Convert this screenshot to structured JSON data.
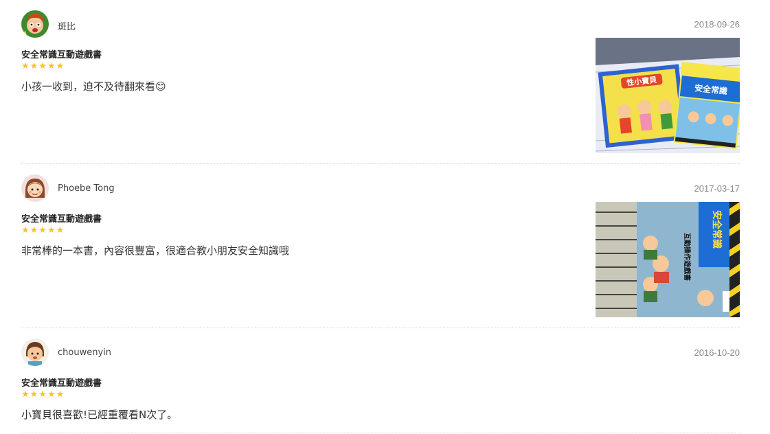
{
  "reviews": [
    {
      "user": "斑比",
      "date": "2018-09-26",
      "product": "安全常識互動遊戲書",
      "rating": 5,
      "stars": "★★★★★",
      "comment": "小孩一收到，迫不及待翻來看😊",
      "avatar_icon": "boy-cartoon-avatar",
      "photo_title_left": "性小寶貝",
      "photo_title_right": "安全常識"
    },
    {
      "user": "Phoebe Tong",
      "date": "2017-03-17",
      "product": "安全常識互動遊戲書",
      "rating": 5,
      "stars": "★★★★★",
      "comment": "非常棒的一本書，內容很豐富，很適合教小朋友安全知識哦",
      "avatar_icon": "girl-cartoon-avatar",
      "photo_title": "安全常識",
      "photo_subtitle": "互動操作遊戲書"
    },
    {
      "user": "chouwenyin",
      "date": "2016-10-20",
      "product": "安全常識互動遊戲書",
      "rating": 5,
      "stars": "★★★★★",
      "comment": "小寶貝很喜歡!已經重覆看N次了。",
      "avatar_icon": "kid-cartoon-avatar"
    }
  ],
  "colors": {
    "star": "#f5c518",
    "divider": "#d8d8d8",
    "date": "#888888"
  }
}
